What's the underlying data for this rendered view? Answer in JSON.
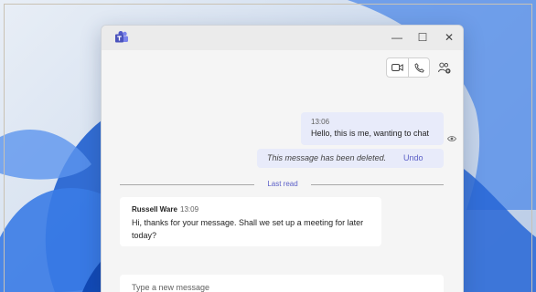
{
  "window": {
    "minimize_glyph": "—",
    "maximize_glyph": "☐",
    "close_glyph": "✕"
  },
  "toolbar": {
    "video_icon": "video-camera-icon",
    "call_icon": "phone-icon",
    "people_icon": "add-people-icon"
  },
  "messages": {
    "outgoing": {
      "time": "13:06",
      "text": "Hello, this is me, wanting to chat"
    },
    "deleted": {
      "text": "This message has been deleted.",
      "undo_label": "Undo"
    },
    "last_read_label": "Last read",
    "incoming": {
      "sender": "Russell Ware",
      "time": "13:09",
      "text": "Hi, thanks for your message. Shall we set up a meeting for later today?"
    }
  },
  "compose": {
    "placeholder": "Type a new message"
  },
  "colors": {
    "accent": "#5b5fc7",
    "my_bubble": "#e8ebfa"
  }
}
